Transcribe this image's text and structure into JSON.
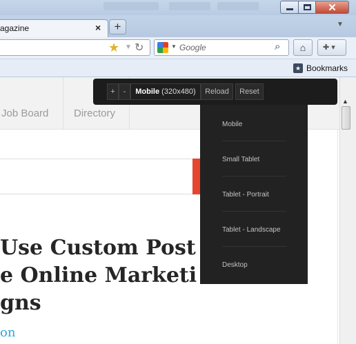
{
  "browser": {
    "tab_title": "agazine",
    "tab_close": "×",
    "new_tab": "+",
    "tab_list": "▼",
    "search_placeholder": "Google",
    "bookmarks_label": "Bookmarks",
    "window_close": "✕",
    "icons": {
      "star": "bookmark-star-icon",
      "reload": "reload-icon",
      "search": "magnifier-icon",
      "home": "home-icon",
      "bookmarks": "bookmarks-star-icon"
    }
  },
  "site": {
    "nav_items": [
      "Job Board",
      "Directory"
    ],
    "headline_lines": [
      "Use Custom Post T",
      "e Online Marketi",
      "gns"
    ],
    "byline": "on",
    "accent_color": "#e6462e",
    "link_color": "#2ea6d8"
  },
  "responsive_tool": {
    "plus": "+",
    "minus": "-",
    "device_name": "Mobile",
    "device_size": "(320x480)",
    "reload": "Reload",
    "reset": "Reset",
    "menu_items": [
      "Mobile",
      "Small Tablet",
      "Tablet - Portrait",
      "Tablet - Landscape",
      "Desktop"
    ]
  }
}
